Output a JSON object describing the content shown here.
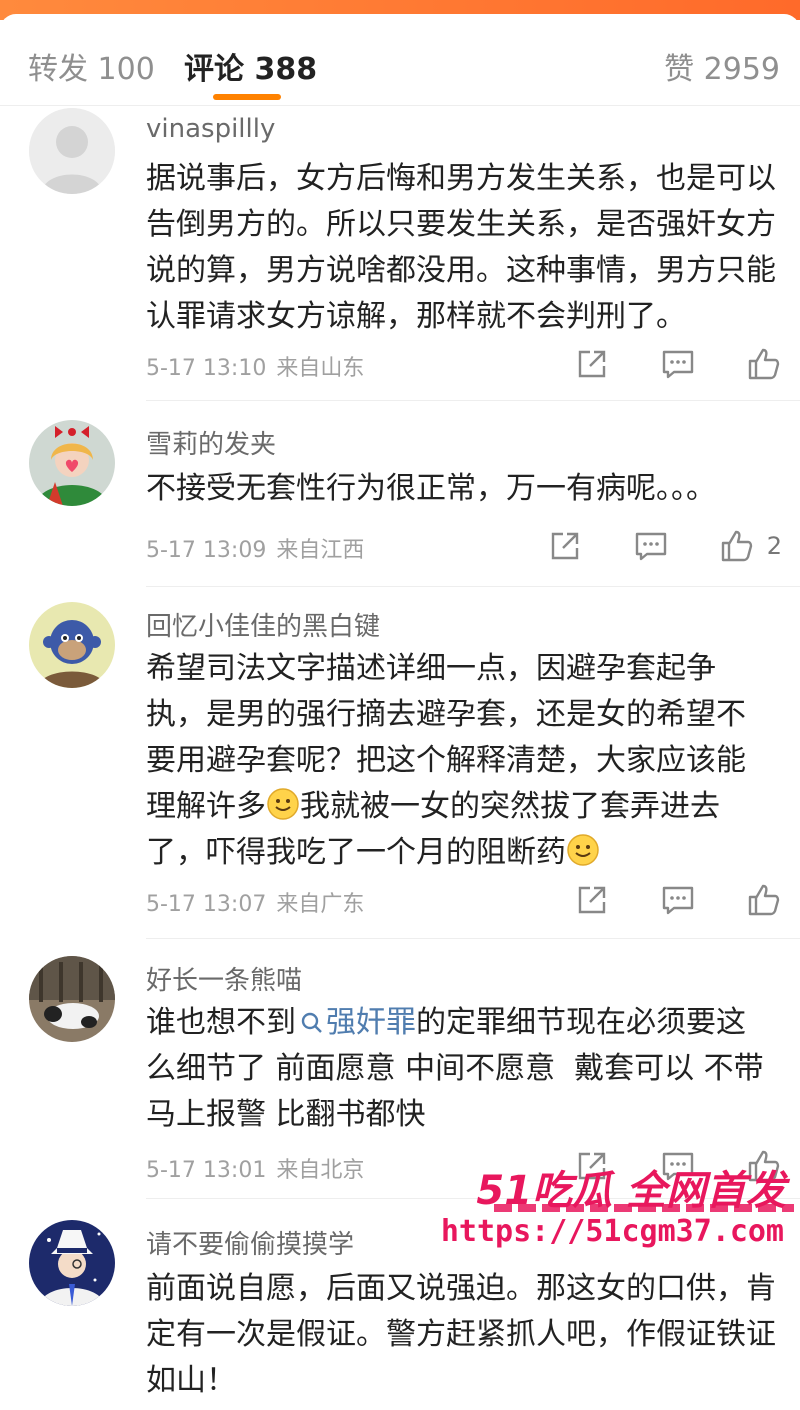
{
  "tabs": {
    "repost": "转发 100",
    "comments": "评论 388",
    "likes": "赞 2959"
  },
  "colors": {
    "accent": "#ff8200",
    "topic_link": "#507daf",
    "watermark": "#e8175d"
  },
  "comments": [
    {
      "username": "vinaspillly",
      "text": "据说事后，女方后悔和男方发生关系，也是可以告倒男方的。所以只要发生关系，是否强奸女方说的算，男方说啥都没用。这种事情，男方只能认罪请求女方谅解，那样就不会判刑了。",
      "time": "5-17 13:10",
      "location": "来自山东",
      "like_count": ""
    },
    {
      "username": "雪莉的发夹",
      "text": "不接受无套性行为很正常，万一有病呢。。。",
      "time": "5-17 13:09",
      "location": "来自江西",
      "like_count": "2"
    },
    {
      "username": "回忆小佳佳的黑白键",
      "text_lines": [
        "希望司法文字描述详细一点，因避孕套起争",
        "执，是男的强行摘去避孕套，还是女的希望不",
        "要用避孕套呢？把这个解释清楚，大家应该能"
      ],
      "line4_a": "理解许多",
      "line4_b": "我就被一女的突然拔了套弄进去",
      "line5": "了，吓得我吃了一个月的阻断药",
      "emoji": "smile-emoji",
      "time": "5-17 13:07",
      "location": "来自广东",
      "like_count": ""
    },
    {
      "username": "好长一条熊喵",
      "pre": "谁也想不到",
      "topic": "强奸罪",
      "post": "的定罪细节现在必须要这",
      "line2": "么细节了 前面愿意 中间不愿意  戴套可以 不带",
      "line3": "马上报警 比翻书都快",
      "time": "5-17 13:01",
      "location": "来自北京",
      "like_count": ""
    },
    {
      "username": "请不要偷偷摸摸学",
      "text": "前面说自愿，后面又说强迫。那这女的口供，肯定有一次是假证。警方赶紧抓人吧，作假证铁证如山！"
    }
  ],
  "watermark": {
    "line1": "51吃瓜 全网首发",
    "url": "https://51cgm37.com"
  }
}
